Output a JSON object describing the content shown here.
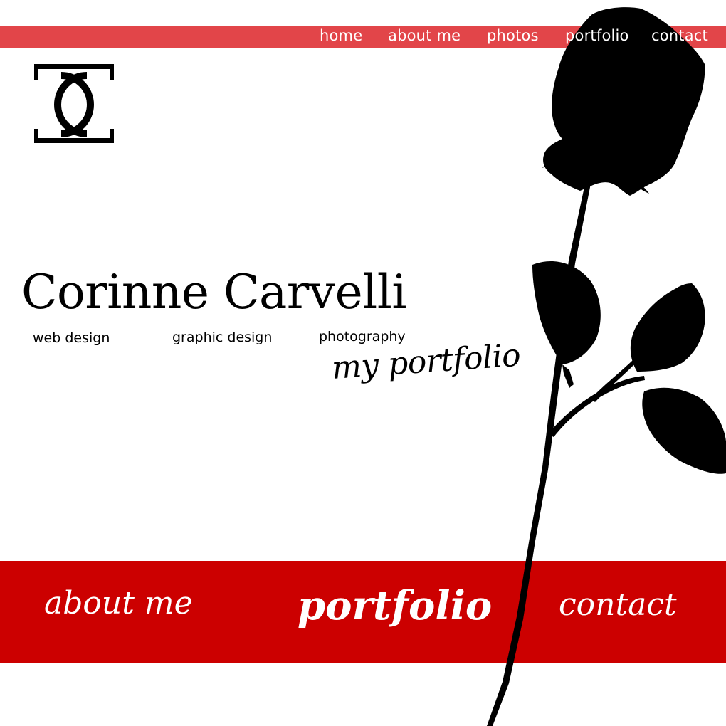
{
  "nav": {
    "items": [
      {
        "label": "home"
      },
      {
        "label": "about me"
      },
      {
        "label": "photos"
      },
      {
        "label": "portfolio"
      },
      {
        "label": "contact"
      }
    ]
  },
  "hero": {
    "monogram": "CC",
    "name": "Corinne Carvelli",
    "services": [
      "web design",
      "graphic design",
      "photography"
    ],
    "tagline": "my portfolio"
  },
  "band": {
    "links": [
      {
        "label": "about me"
      },
      {
        "label": "portfolio"
      },
      {
        "label": "contact"
      }
    ]
  },
  "colors": {
    "nav_bar": "#e24549",
    "band": "#cc0000",
    "rose": "#000000",
    "text": "#000000"
  },
  "icons": {
    "logo": "cc-monogram-logo",
    "decoration": "rose-silhouette-icon"
  }
}
